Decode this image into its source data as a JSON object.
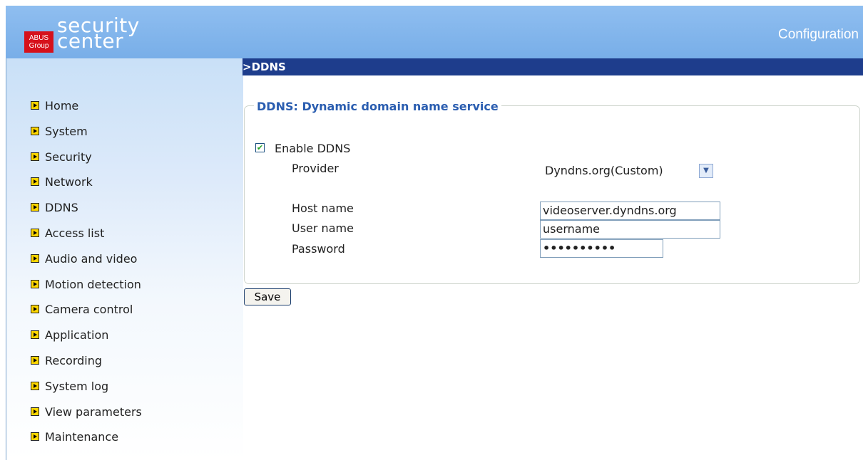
{
  "header": {
    "logo_brand_line1": "ABUS",
    "logo_brand_line2": "Group",
    "logo_text_line1": "security",
    "logo_text_line2": "center",
    "title": "Configuration"
  },
  "sidebar": {
    "items": [
      {
        "label": "Home"
      },
      {
        "label": "System"
      },
      {
        "label": "Security"
      },
      {
        "label": "Network"
      },
      {
        "label": "DDNS"
      },
      {
        "label": "Access list"
      },
      {
        "label": "Audio and video"
      },
      {
        "label": "Motion detection"
      },
      {
        "label": "Camera control"
      },
      {
        "label": "Application"
      },
      {
        "label": "Recording"
      },
      {
        "label": "System log"
      },
      {
        "label": "View parameters"
      },
      {
        "label": "Maintenance"
      }
    ]
  },
  "section": {
    "breadcrumb": ">DDNS"
  },
  "form": {
    "legend": "DDNS: Dynamic domain name service",
    "enable_label": "Enable DDNS",
    "enable_checked": true,
    "provider_label": "Provider",
    "provider_value": "Dyndns.org(Custom)",
    "host_label": "Host name",
    "host_value": "videoserver.dyndns.org",
    "user_label": "User name",
    "user_value": "username",
    "password_label": "Password",
    "password_value": "••••••••••",
    "save_label": "Save"
  },
  "colors": {
    "header_bg": "#8fbef0",
    "section_bar_bg": "#1e3d8c",
    "legend_text": "#2a5db0",
    "logo_red": "#d6111b"
  }
}
